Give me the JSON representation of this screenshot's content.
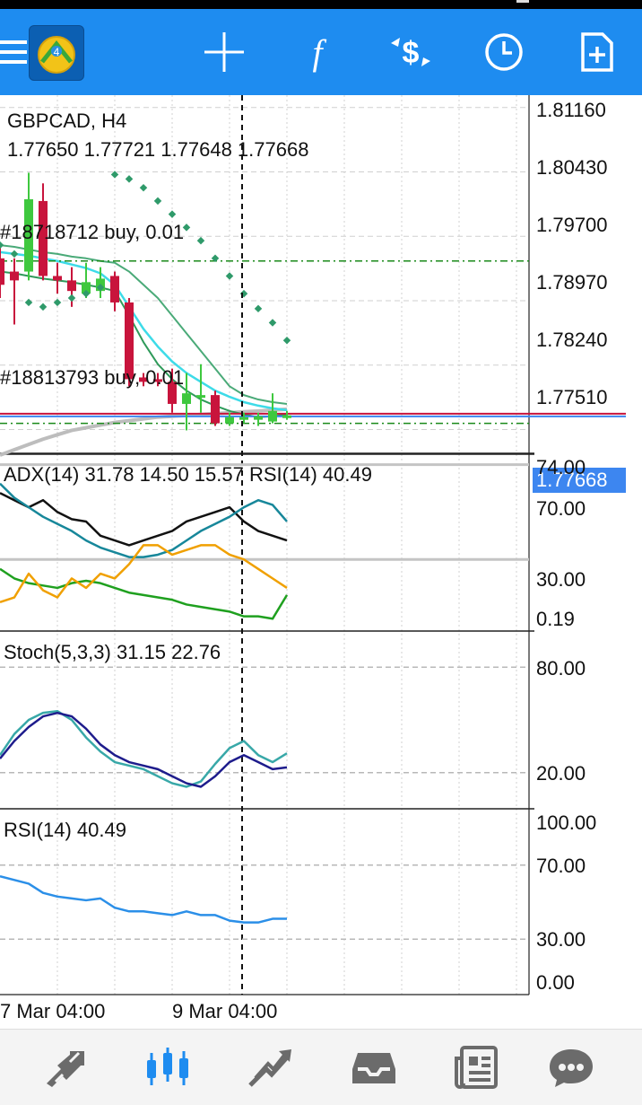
{
  "toolbar": {
    "icons": [
      "menu-icon",
      "metatrader-logo",
      "crosshair-icon",
      "indicator-function-icon",
      "trade-dollar-icon",
      "history-clock-icon",
      "new-order-icon"
    ]
  },
  "main_chart": {
    "symbol_title": "GBPCAD, H4",
    "ohlc": "1.77650 1.77721 1.77648 1.77668",
    "order_label_1": "#18718712 buy, 0.01",
    "order_label_2": "#18813793 buy, 0.01",
    "current_price": "1.77668",
    "hidden_level": "1.77510",
    "price_axis": [
      "1.81160",
      "1.80430",
      "1.79700",
      "1.78970",
      "1.78240"
    ]
  },
  "adx_panel": {
    "title": "ADX(14) 31.78 14.50 15.57 RSI(14) 40.49",
    "axis": [
      "74.00",
      "70.00",
      "30.00",
      "0.19"
    ]
  },
  "stoch_panel": {
    "title": "Stoch(5,3,3) 31.15 22.76",
    "axis": [
      "80.00",
      "20.00"
    ]
  },
  "rsi_panel": {
    "title": "RSI(14) 40.49",
    "axis": [
      "100.00",
      "70.00",
      "30.00",
      "0.00"
    ]
  },
  "time_axis": [
    "7 Mar 04:00",
    "9 Mar 04:00"
  ],
  "colors": {
    "toolbar": "#1e8cf0",
    "bull_candle": "#3ec83e",
    "bear_candle": "#c8143c",
    "price_tag": "#3d86f0",
    "order_line": "#1a8a1a"
  },
  "bottom_nav": {
    "icons": [
      "quotes-icon",
      "chart-icon",
      "trade-icon",
      "history-icon",
      "news-icon",
      "chat-icon"
    ],
    "active": "chart-icon"
  },
  "chart_data": [
    {
      "type": "candlestick",
      "title": "GBPCAD, H4",
      "ylim": [
        1.7725,
        1.813
      ],
      "candles": [
        {
          "o": 1.7945,
          "h": 1.796,
          "l": 1.79,
          "c": 1.7915
        },
        {
          "o": 1.793,
          "h": 1.7945,
          "l": 1.787,
          "c": 1.792
        },
        {
          "o": 1.793,
          "h": 1.8042,
          "l": 1.792,
          "c": 1.8012
        },
        {
          "o": 1.801,
          "h": 1.803,
          "l": 1.792,
          "c": 1.7925
        },
        {
          "o": 1.7925,
          "h": 1.794,
          "l": 1.7905,
          "c": 1.792
        },
        {
          "o": 1.792,
          "h": 1.7935,
          "l": 1.789,
          "c": 1.7908
        },
        {
          "o": 1.7905,
          "h": 1.794,
          "l": 1.79,
          "c": 1.7918
        },
        {
          "o": 1.7908,
          "h": 1.7935,
          "l": 1.79,
          "c": 1.7922
        },
        {
          "o": 1.7925,
          "h": 1.793,
          "l": 1.7885,
          "c": 1.7895
        },
        {
          "o": 1.7895,
          "h": 1.79,
          "l": 1.78,
          "c": 1.7808
        },
        {
          "o": 1.781,
          "h": 1.7815,
          "l": 1.78,
          "c": 1.7805
        },
        {
          "o": 1.7808,
          "h": 1.7815,
          "l": 1.78,
          "c": 1.7805
        },
        {
          "o": 1.7805,
          "h": 1.782,
          "l": 1.777,
          "c": 1.778
        },
        {
          "o": 1.778,
          "h": 1.7815,
          "l": 1.775,
          "c": 1.7792
        },
        {
          "o": 1.779,
          "h": 1.7825,
          "l": 1.777,
          "c": 1.779
        },
        {
          "o": 1.779,
          "h": 1.7795,
          "l": 1.7755,
          "c": 1.7758
        },
        {
          "o": 1.7758,
          "h": 1.777,
          "l": 1.7755,
          "c": 1.7765
        },
        {
          "o": 1.7765,
          "h": 1.777,
          "l": 1.7758,
          "c": 1.7765
        },
        {
          "o": 1.7762,
          "h": 1.777,
          "l": 1.7755,
          "c": 1.7766
        },
        {
          "o": 1.776,
          "h": 1.7792,
          "l": 1.7758,
          "c": 1.7772
        },
        {
          "o": 1.7765,
          "h": 1.7772,
          "l": 1.7762,
          "c": 1.7767
        }
      ],
      "parabolic_sar": [
        1.796,
        1.795,
        1.7895,
        1.789,
        1.7895,
        1.79,
        1.7905,
        1.7912,
        1.804,
        1.8035,
        1.8025,
        1.801,
        1.7995,
        1.798,
        1.7965,
        1.7945,
        1.7925,
        1.7905,
        1.7888,
        1.7872,
        1.7852
      ],
      "ma_fast": [
        1.7952,
        1.795,
        1.7948,
        1.7945,
        1.7942,
        1.7938,
        1.7934,
        1.7928,
        1.7915,
        1.789,
        1.7865,
        1.7845,
        1.7828,
        1.7815,
        1.7805,
        1.7795,
        1.7788,
        1.7782,
        1.7778,
        1.7775,
        1.7773
      ],
      "ma_green_upper": [
        1.796,
        1.7958,
        1.7955,
        1.7952,
        1.795,
        1.7947,
        1.7945,
        1.7942,
        1.794,
        1.793,
        1.7915,
        1.79,
        1.788,
        1.786,
        1.784,
        1.782,
        1.78,
        1.779,
        1.7785,
        1.7782,
        1.778
      ],
      "ma_green_lower": [
        1.793,
        1.7928,
        1.7925,
        1.7922,
        1.792,
        1.7918,
        1.7915,
        1.7912,
        1.7908,
        1.788,
        1.785,
        1.7825,
        1.7808,
        1.7795,
        1.7785,
        1.7778,
        1.7772,
        1.7768,
        1.7765,
        1.7766,
        1.7768
      ],
      "ma_slow": [
        1.7722,
        1.7728,
        1.7734,
        1.774,
        1.7745,
        1.775,
        1.7753,
        1.7756,
        1.7759,
        1.7761,
        1.7763,
        1.7765,
        1.7766,
        1.7767,
        1.7768,
        1.7769,
        1.777,
        1.7771,
        1.7772,
        1.7773,
        1.7774
      ],
      "order_levels": [
        1.7942,
        1.7758
      ],
      "current_price": 1.77668
    },
    {
      "type": "line",
      "title": "ADX(14) 31.78 14.50 15.57 RSI(14) 40.49",
      "ylim": [
        0.19,
        74.0
      ],
      "levels": [
        70,
        30
      ],
      "series": [
        {
          "values": [
            58,
            55,
            52,
            55,
            50,
            47,
            46,
            40,
            38,
            36,
            38,
            40,
            42,
            46,
            48,
            50,
            52,
            46,
            42,
            40,
            38
          ],
          "color": "#121212"
        },
        {
          "values": [
            62,
            56,
            52,
            48,
            45,
            42,
            38,
            35,
            33,
            31,
            31,
            32,
            34,
            38,
            42,
            45,
            48,
            52,
            55,
            53,
            46
          ],
          "color": "#17879a"
        },
        {
          "values": [
            26,
            22,
            20,
            19,
            18,
            20,
            21,
            20,
            18,
            16,
            15,
            14,
            13,
            11,
            10,
            9,
            8,
            6,
            6,
            5,
            15
          ],
          "color": "#1fa01f"
        },
        {
          "values": [
            12,
            14,
            24,
            17,
            14,
            22,
            18,
            24,
            22,
            28,
            36,
            36,
            32,
            34,
            36,
            36,
            32,
            30,
            26,
            22,
            18
          ],
          "color": "#f0a000"
        }
      ]
    },
    {
      "type": "line",
      "title": "Stoch(5,3,3) 31.15 22.76",
      "ylim": [
        0,
        100
      ],
      "levels": [
        80,
        20
      ],
      "series": [
        {
          "values": [
            30,
            42,
            50,
            54,
            55,
            50,
            40,
            32,
            26,
            24,
            22,
            18,
            14,
            12,
            15,
            25,
            34,
            38,
            30,
            26,
            31
          ],
          "color": "#38a8a8"
        },
        {
          "values": [
            28,
            38,
            46,
            52,
            54,
            52,
            45,
            36,
            30,
            26,
            24,
            22,
            18,
            14,
            12,
            18,
            26,
            30,
            26,
            22,
            23
          ],
          "color": "#1e1c8c"
        }
      ]
    },
    {
      "type": "line",
      "title": "RSI(14) 40.49",
      "ylim": [
        0,
        100
      ],
      "levels": [
        70,
        30
      ],
      "series": [
        {
          "values": [
            64,
            62,
            60,
            55,
            53,
            52,
            51,
            52,
            47,
            45,
            45,
            44,
            43,
            45,
            43,
            43,
            40,
            39,
            39,
            41,
            41
          ],
          "color": "#2b8fe8"
        }
      ]
    }
  ]
}
